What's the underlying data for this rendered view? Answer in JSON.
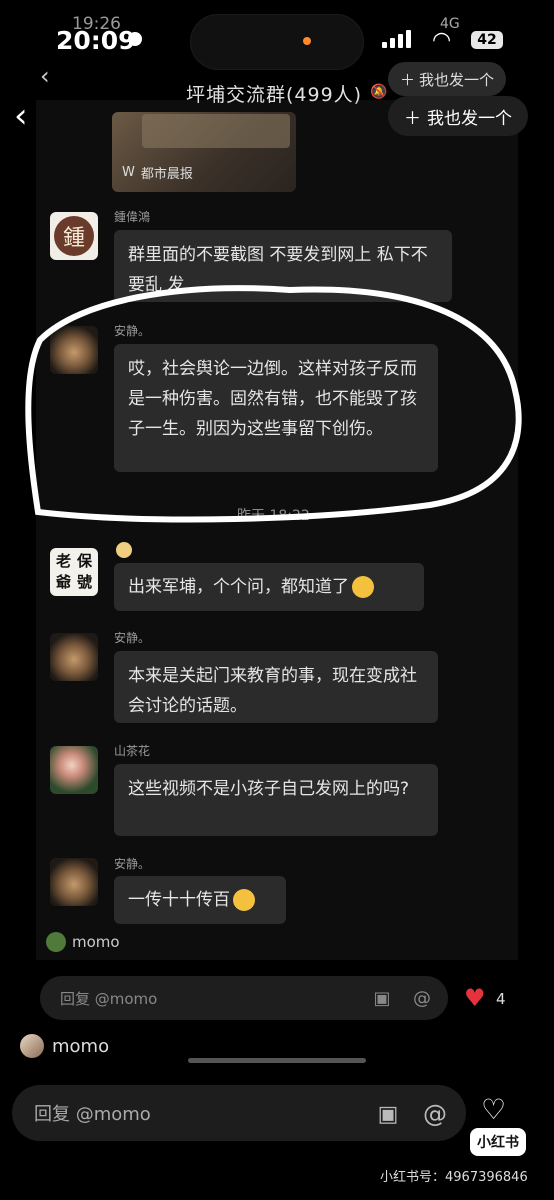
{
  "outer_status": {
    "time": "20:09",
    "ghost_time": "19:26",
    "network": "4G",
    "battery": "42"
  },
  "header": {
    "title": "坪埔交流群(499人)",
    "join_button": "我也发一个",
    "join_button_inner": "我也发一个"
  },
  "share_card": {
    "source": "都市晨报"
  },
  "messages": [
    {
      "sender": "鍾偉鴻",
      "text": "群里面的不要截图 不要发到网上 私下不要乱 发",
      "avatar": "鍾"
    },
    {
      "sender": "安静。",
      "text": "哎，社会舆论一边倒。这样对孩子反而是一种伤害。固然有错，也不能毁了孩子一生。别因为这些事留下创伤。"
    },
    {
      "sender": "",
      "text": "出来军埔，个个问，都知道了",
      "avatar_chars": [
        "老",
        "保",
        "爺",
        "號"
      ]
    },
    {
      "sender": "安静。",
      "text": "本来是关起门来教育的事，现在变成社会讨论的话题。"
    },
    {
      "sender": "山茶花",
      "text": "这些视频不是小孩子自己发网上的吗?"
    },
    {
      "sender": "安静。",
      "text": "一传十十传百"
    }
  ],
  "time_separator": "昨天 18:22",
  "inner_comment": {
    "user": "momo",
    "reply_placeholder": "回复 @momo",
    "likes": "4"
  },
  "outer_comment": {
    "user": "momo",
    "reply_placeholder": "回复 @momo"
  },
  "watermark": {
    "logo": "小红书",
    "id": "小红书号：4967396846"
  },
  "colors": {
    "accent_heart": "#e5323c",
    "bubble": "#2b2b2b",
    "annotation_circle": "#ffffff"
  }
}
